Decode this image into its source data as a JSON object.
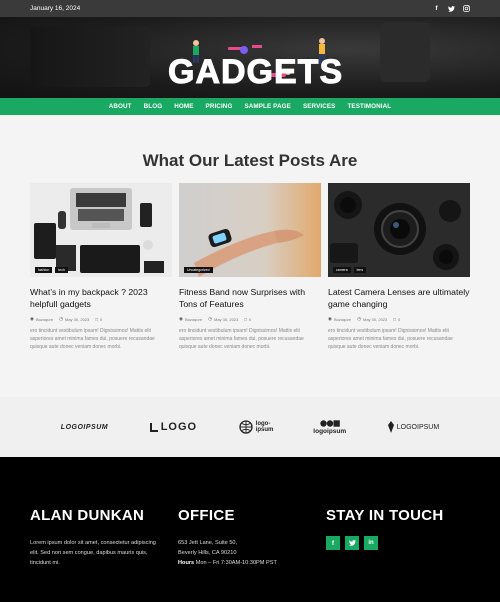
{
  "topbar": {
    "date": "January 16, 2024",
    "social": [
      "facebook-icon",
      "twitter-icon",
      "instagram-icon"
    ]
  },
  "brand": {
    "logo_text": "GADGETS"
  },
  "nav": {
    "items": [
      "ABOUT",
      "BLOG",
      "HOME",
      "PRICING",
      "SAMPLE PAGE",
      "SERVICES",
      "TESTIMONIAL"
    ]
  },
  "posts": {
    "title": "What Our Latest Posts Are",
    "cards": [
      {
        "tags": [
          "fashion",
          "tech"
        ],
        "title": "What’s in my backpack ? 2023 helpfull gadgets",
        "author": "Bozoqure",
        "date": "May 30, 2023",
        "comments": "0",
        "excerpt": "ero tincidunt vestibulum ipsam! Dignissimos! Mattis elit asperiores amet minima fames dui, posuere recusandae quisque aute donec veniam donec morbi."
      },
      {
        "tags": [
          "Uncategorized"
        ],
        "title": "Fitness Band now Surprises with Tons of Features",
        "author": "Bozoqure",
        "date": "May 30, 2023",
        "comments": "0",
        "excerpt": "ero tincidunt vestibulum ipsam! Dignissimos! Mattis elit asperiores amet minima fames dui, posuere recusandae quisque aute donec veniam donec morbi."
      },
      {
        "tags": [
          "camera",
          "lens"
        ],
        "title": "Latest Camera Lenses are ultimately game changing",
        "author": "Bozoqure",
        "date": "May 30, 2023",
        "comments": "0",
        "excerpt": "ero tincidunt vestibulum ipsam! Dignissimos! Mattis elit asperiores amet minima fames dui, posuere recusandae quisque aute donec veniam donec morbi."
      }
    ]
  },
  "logos": {
    "items": [
      "LOGOIPSUM",
      "LOGO",
      "logo-ipsum",
      "logoipsum",
      "LOGOIPSUM"
    ]
  },
  "footer": {
    "col1": {
      "title": "ALAN DUNKAN",
      "text": "Lorem ipsum dolor sit amet, consectetur adipiscing elit. Sed non sem congue, dapibus mauris quis, tincidunt mi."
    },
    "col2": {
      "title": "OFFICE",
      "line1": "653 Jett Lane, Suite 50,",
      "line2": "Beverly Hills, CA 90210",
      "hours_label": "Hours",
      "hours_value": "Mon – Fri 7:30AM-10:30PM PST"
    },
    "col3": {
      "title": "STAY IN TOUCH",
      "social": [
        "facebook-icon",
        "twitter-icon",
        "linkedin-icon"
      ]
    }
  },
  "colors": {
    "accent": "#1aa963",
    "topbar": "#3a3a3a",
    "footer": "#000000"
  }
}
